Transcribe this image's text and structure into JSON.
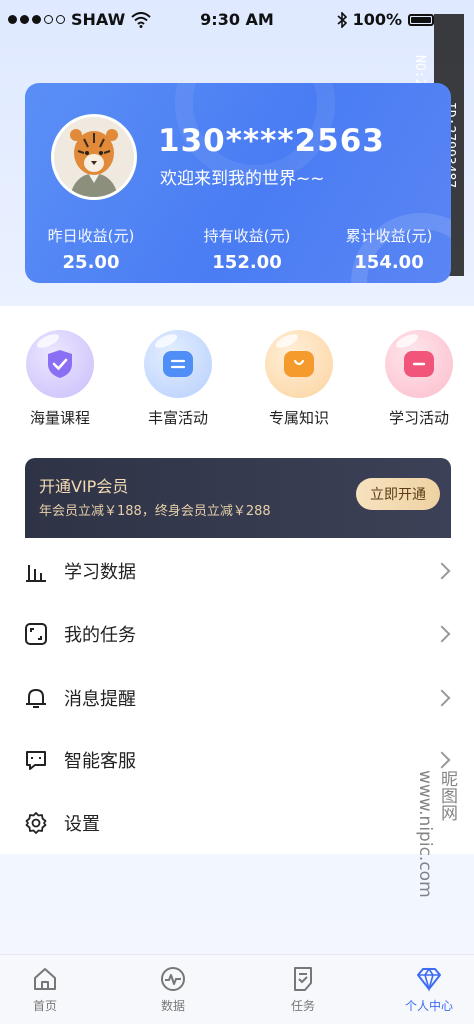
{
  "status_bar": {
    "carrier": "SHAW",
    "time": "9:30 AM",
    "battery": "100%"
  },
  "watermark": {
    "id_text": "ID:27993487 NO:20250604141948102100",
    "site_text": "昵图网 www.nipic.com"
  },
  "profile": {
    "phone": "130****2563",
    "welcome": "欢迎来到我的世界~~",
    "stats": [
      {
        "label": "昨日收益(元)",
        "value": "25.00"
      },
      {
        "label": "持有收益(元)",
        "value": "152.00"
      },
      {
        "label": "累计收益(元)",
        "value": "154.00"
      }
    ]
  },
  "quick_actions": [
    {
      "label": "海量课程",
      "icon": "shield-check-icon",
      "color": "#8a6ff4"
    },
    {
      "label": "丰富活动",
      "icon": "list-icon",
      "color": "#4f8ef6"
    },
    {
      "label": "专属知识",
      "icon": "smile-box-icon",
      "color": "#f59a2c"
    },
    {
      "label": "学习活动",
      "icon": "minus-box-icon",
      "color": "#f2557a"
    }
  ],
  "vip": {
    "title": "开通VIP会员",
    "desc": "年会员立减￥188，终身会员立减￥288",
    "button": "立即开通"
  },
  "menu": [
    {
      "label": "学习数据",
      "icon": "bar-chart-icon",
      "arrow": true
    },
    {
      "label": "我的任务",
      "icon": "task-box-icon",
      "arrow": true
    },
    {
      "label": "消息提醒",
      "icon": "bell-icon",
      "arrow": true
    },
    {
      "label": "智能客服",
      "icon": "chat-bubble-icon",
      "arrow": true
    },
    {
      "label": "设置",
      "icon": "gear-icon",
      "arrow": false
    }
  ],
  "tabs": [
    {
      "label": "首页",
      "icon": "home-icon",
      "active": false
    },
    {
      "label": "数据",
      "icon": "pulse-icon",
      "active": false
    },
    {
      "label": "任务",
      "icon": "task-icon",
      "active": false
    },
    {
      "label": "个人中心",
      "icon": "diamond-icon",
      "active": true
    }
  ],
  "colors": {
    "accent": "#4a7cf3",
    "vip_bg": "#2f3346",
    "vip_gold": "#f3dcb3"
  }
}
